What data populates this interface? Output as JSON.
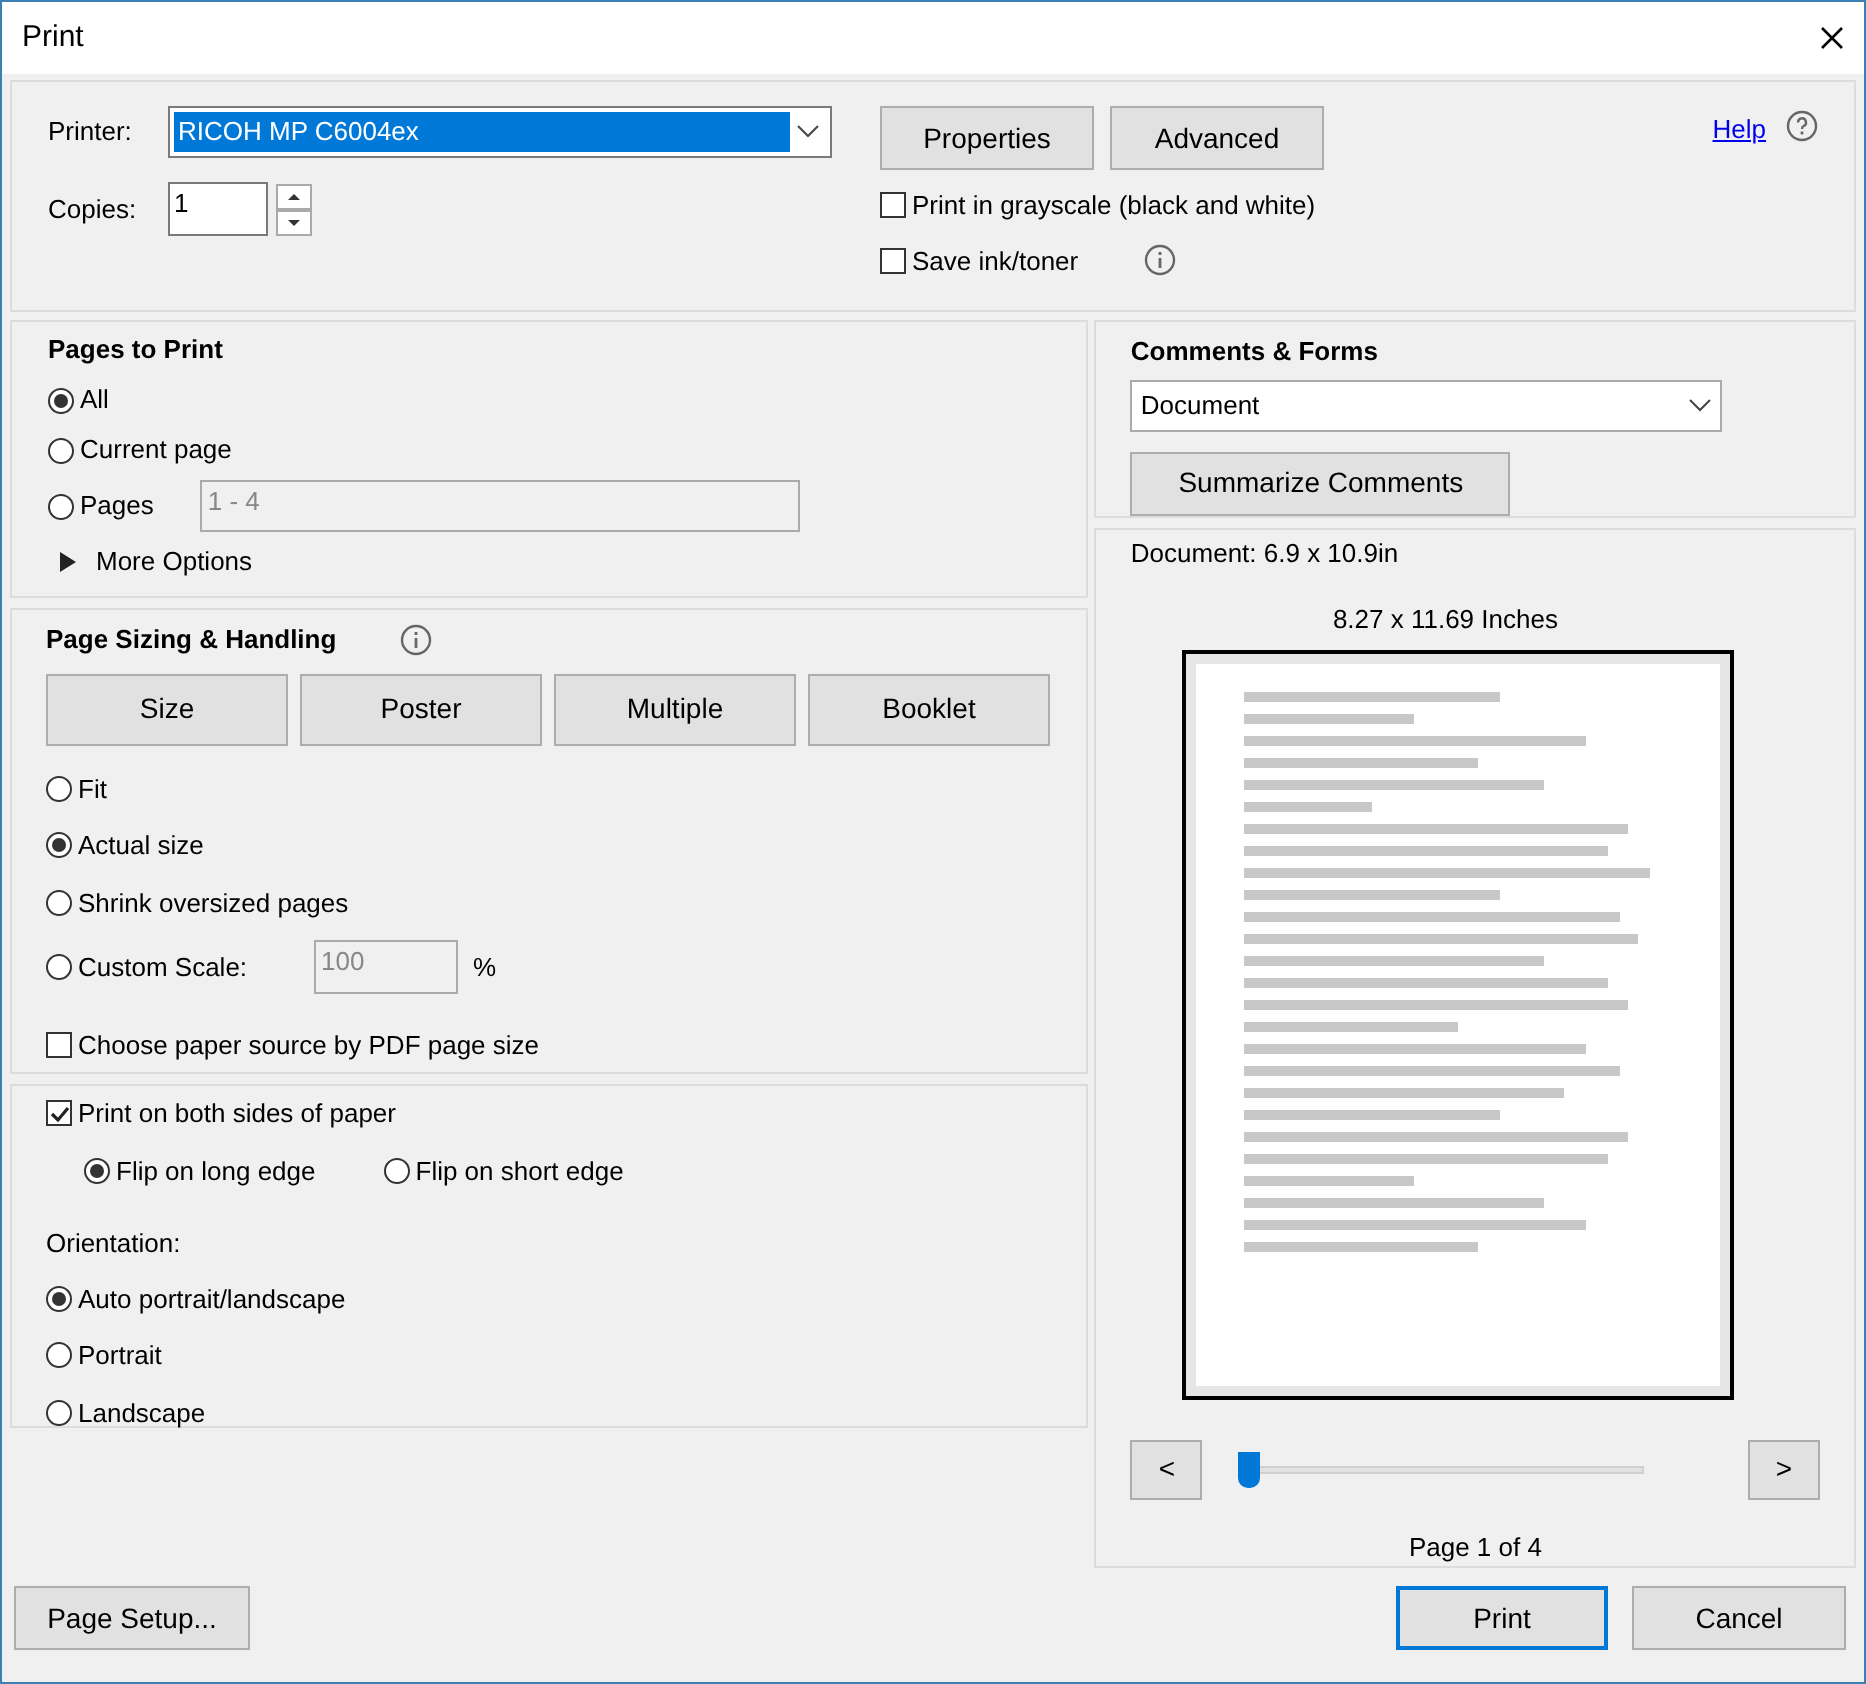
{
  "window": {
    "title": "Print"
  },
  "printer": {
    "label": "Printer:",
    "value": "RICOH MP C6004ex",
    "buttons": [
      "Properties",
      "Advanced"
    ],
    "help": "Help"
  },
  "copies": {
    "label": "Copies:",
    "value": "1"
  },
  "print_options": [
    {
      "label": "Print in grayscale (black and white)",
      "checked": false,
      "info": false
    },
    {
      "label": "Save ink/toner",
      "checked": false,
      "info": true
    }
  ],
  "pages_to_print": {
    "title": "Pages to Print",
    "options": [
      {
        "label": "All",
        "selected": true
      },
      {
        "label": "Current page",
        "selected": false
      },
      {
        "label": "Pages",
        "selected": false,
        "field": "1 - 4"
      }
    ],
    "more_options": "More Options",
    "expanded": false
  },
  "page_sizing": {
    "title": "Page Sizing & Handling",
    "buttons": [
      "Size",
      "Poster",
      "Multiple",
      "Booklet"
    ],
    "options": [
      {
        "label": "Fit",
        "selected": false
      },
      {
        "label": "Actual size",
        "selected": true
      },
      {
        "label": "Shrink oversized pages",
        "selected": false
      },
      {
        "label": "Custom Scale:",
        "selected": false,
        "field": "100",
        "suffix": "%"
      }
    ],
    "paper_source": {
      "label": "Choose paper source by PDF page size",
      "checked": false
    }
  },
  "duplex": {
    "label": "Print on both sides of paper",
    "checked": true,
    "options": [
      {
        "label": "Flip on long edge",
        "selected": true
      },
      {
        "label": "Flip on short edge",
        "selected": false
      }
    ]
  },
  "orientation": {
    "title": "Orientation:",
    "options": [
      {
        "label": "Auto portrait/landscape",
        "selected": true
      },
      {
        "label": "Portrait",
        "selected": false
      },
      {
        "label": "Landscape",
        "selected": false
      }
    ]
  },
  "comments_forms": {
    "title": "Comments & Forms",
    "value": "Document",
    "button": "Summarize Comments"
  },
  "preview": {
    "document_size": "Document: 6.9 x 10.9in",
    "paper_size": "8.27 x 11.69 Inches",
    "prev": "<",
    "next": ">",
    "level": 0,
    "page_label": "Page 1 of 4"
  },
  "footer": {
    "page_setup": "Page Setup...",
    "print": "Print",
    "cancel": "Cancel"
  }
}
